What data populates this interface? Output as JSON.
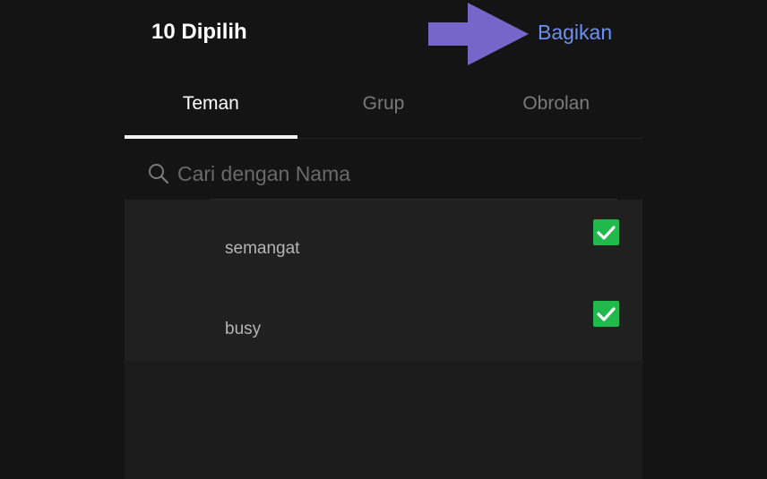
{
  "header": {
    "title": "10 Dipilih",
    "share_label": "Bagikan"
  },
  "tabs": [
    {
      "label": "Teman",
      "active": true
    },
    {
      "label": "Grup",
      "active": false
    },
    {
      "label": "Obrolan",
      "active": false
    }
  ],
  "search": {
    "placeholder": "Cari dengan Nama",
    "value": ""
  },
  "friends": [
    {
      "name": "semangat",
      "checked": true
    },
    {
      "name": "busy",
      "checked": true
    }
  ],
  "colors": {
    "accent": "#6f8ff0",
    "checkbox": "#21b94b",
    "arrow": "#7766c9"
  },
  "icons": {
    "search": "search-icon",
    "check": "check-icon",
    "arrow": "arrow-right-icon"
  }
}
